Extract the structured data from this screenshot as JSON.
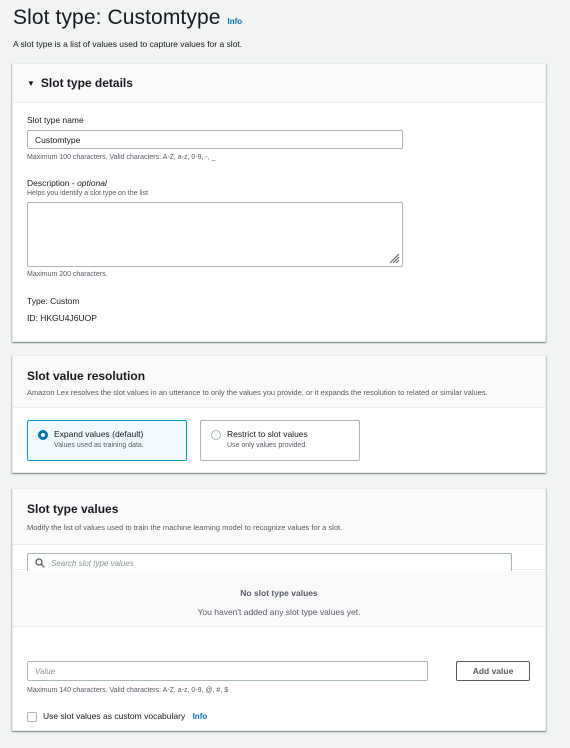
{
  "header": {
    "title": "Slot type: Customtype",
    "info_label": "Info",
    "description": "A slot type is a list of values used to capture values for a slot."
  },
  "details": {
    "heading": "Slot type details",
    "name_label": "Slot type name",
    "name_value": "Customtype",
    "name_hint": "Maximum 100 characters. Valid characters: A-Z, a-z, 0-9, -, _",
    "description_label": "Description - ",
    "description_optional": "optional",
    "description_help": "Helps you identify a slot type on the list",
    "description_value": "",
    "description_hint": "Maximum 200 characters.",
    "type_text": "Type: Custom",
    "id_text": "ID: HKGU4J6UOP"
  },
  "resolution": {
    "heading": "Slot value resolution",
    "description": "Amazon Lex resolves the slot values in an utterance to only the values you provide, or it expands the resolution to related or similar values.",
    "options": [
      {
        "label": "Expand values (default)",
        "sub": "Values used as training data.",
        "selected": true
      },
      {
        "label": "Restrict to slot values",
        "sub": "Use only values provided.",
        "selected": false
      }
    ]
  },
  "values": {
    "heading": "Slot type values",
    "description": "Modify the list of values used to train the machine learning model to recognize values for a slot.",
    "search_placeholder": "Search slot type values",
    "empty_title": "No slot type values",
    "empty_sub": "You haven't added any slot type values yet.",
    "value_placeholder": "Value",
    "add_button": "Add value",
    "value_hint": "Maximum 140 characters. Valid characters: A-Z, a-z, 0-9, @, #, $",
    "vocab_label": "Use slot values as custom vocabulary",
    "vocab_info": "Info"
  },
  "colors": {
    "link": "#0073bb",
    "selected_border": "#00a1c9",
    "selected_bg": "#f1faff"
  }
}
